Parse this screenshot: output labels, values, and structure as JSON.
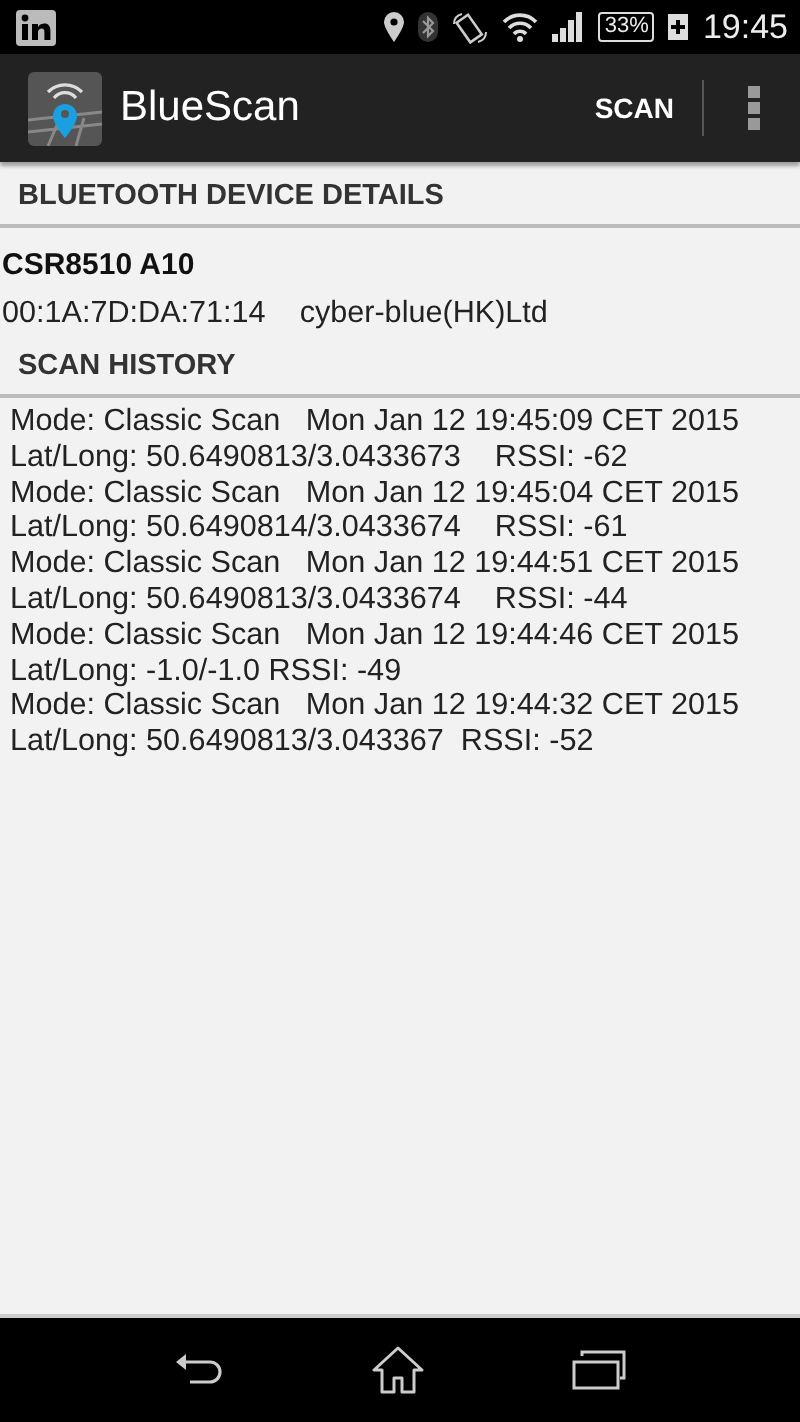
{
  "status_bar": {
    "battery": "33%",
    "time": "19:45"
  },
  "action_bar": {
    "title": "BlueScan",
    "action": "SCAN"
  },
  "device_section": {
    "header": "BLUETOOTH DEVICE DETAILS",
    "name": "CSR8510 A10",
    "address": "00:1A:7D:DA:71:14",
    "vendor": "cyber-blue(HK)Ltd"
  },
  "history_section": {
    "header": "SCAN HISTORY",
    "entries": [
      {
        "line_1": "Mode: Classic Scan   Mon Jan 12 19:45:09 CET 2015",
        "line_2": "Lat/Long: 50.6490813/3.0433673    RSSI: -62"
      },
      {
        "line_1": "Mode: Classic Scan   Mon Jan 12 19:45:04 CET 2015",
        "line_2": "Lat/Long: 50.6490814/3.0433674    RSSI: -61"
      },
      {
        "line_1": "Mode: Classic Scan   Mon Jan 12 19:44:51 CET 2015",
        "line_2": "Lat/Long: 50.6490813/3.0433674    RSSI: -44"
      },
      {
        "line_1": "Mode: Classic Scan   Mon Jan 12 19:44:46 CET 2015",
        "line_2": "Lat/Long: -1.0/-1.0 RSSI: -49"
      },
      {
        "line_1": "Mode: Classic Scan   Mon Jan 12 19:44:32 CET 2015",
        "line_2": "Lat/Long: 50.6490813/3.043367  RSSI: -52"
      }
    ]
  }
}
